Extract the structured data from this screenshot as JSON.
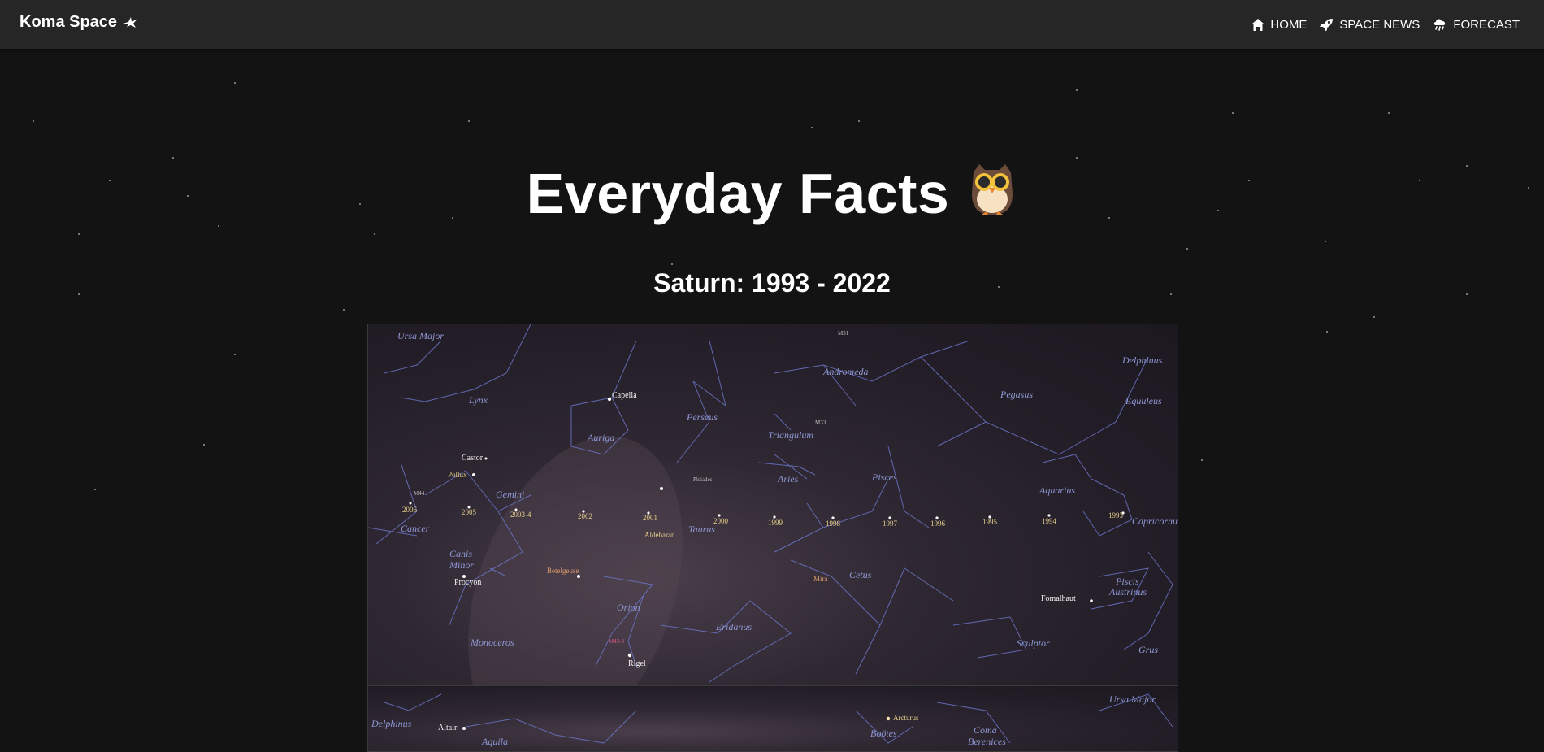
{
  "navbar": {
    "brand": "Koma Space",
    "brand_icon": "flying-bird-icon",
    "links": [
      {
        "label": "HOME",
        "icon": "home-icon"
      },
      {
        "label": "SPACE NEWS",
        "icon": "rocket-icon"
      },
      {
        "label": "FORECAST",
        "icon": "cloud-rain-icon"
      }
    ]
  },
  "hero": {
    "title": "Everyday Facts",
    "title_icon": "owl-icon",
    "subtitle": "Saturn: 1993 - 2022"
  },
  "sky_map": {
    "constellations": [
      "Ursa Major",
      "Lynx",
      "Capella",
      "Auriga",
      "Perseus",
      "Andromeda",
      "Triangulum",
      "Pegasus",
      "Delphinus",
      "Equuleus",
      "Gemini",
      "Cancer",
      "Canis Minor",
      "Aries",
      "Pisces",
      "Aquarius",
      "Capricornus",
      "Taurus",
      "Orion",
      "Eridanus",
      "Cetus",
      "Piscis Austrinus",
      "Monoceros",
      "Sculptor",
      "Grus"
    ],
    "stars": [
      "Castor",
      "Pollux",
      "Procyon",
      "Betelgeuse",
      "Aldebaran",
      "Rigel",
      "Fomalhaut",
      "Mira",
      "Pleiades"
    ],
    "deep_sky": [
      "M44",
      "M42-3",
      "M31",
      "M33"
    ],
    "years": [
      "2006",
      "2005",
      "2003-4",
      "2002",
      "2001",
      "2000",
      "1999",
      "1998",
      "1997",
      "1996",
      "1995",
      "1994",
      "1993"
    ],
    "lower_panel": [
      "Delphinus",
      "Altair",
      "Aquila",
      "Arcturus",
      "Boötes",
      "Coma Berenices",
      "Ursa Major"
    ]
  }
}
